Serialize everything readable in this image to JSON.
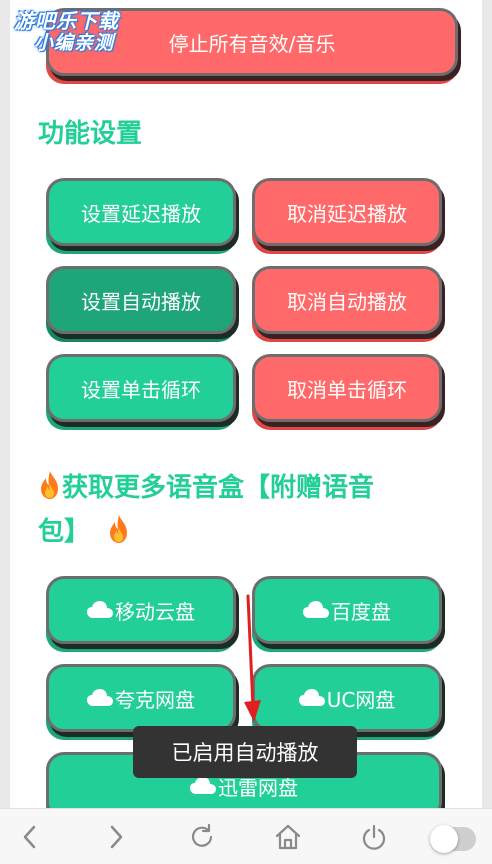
{
  "watermark": {
    "line1": "游吧乐下载",
    "line2": "小编亲测"
  },
  "top_button": {
    "label": "停止所有音效/音乐"
  },
  "settings": {
    "title": "功能设置",
    "buttons": [
      {
        "label": "设置延迟播放",
        "style": "green"
      },
      {
        "label": "取消延迟播放",
        "style": "red"
      },
      {
        "label": "设置自动播放",
        "style": "green-active"
      },
      {
        "label": "取消自动播放",
        "style": "red"
      },
      {
        "label": "设置单击循环",
        "style": "green"
      },
      {
        "label": "取消单击循环",
        "style": "red"
      }
    ]
  },
  "more": {
    "title_part1": "获取更多语音盒【附赠语音",
    "title_part2": "包】",
    "icon": "fire-icon",
    "links": [
      {
        "label": "移动云盘",
        "icon": "cloud-icon"
      },
      {
        "label": "百度盘",
        "icon": "cloud-icon"
      },
      {
        "label": "夸克网盘",
        "icon": "cloud-icon"
      },
      {
        "label": "UC网盘",
        "icon": "cloud-icon"
      },
      {
        "label": "迅雷网盘",
        "icon": "cloud-icon"
      }
    ]
  },
  "toast": {
    "text": "已启用自动播放"
  },
  "bottom_nav": {
    "items": [
      "back-icon",
      "forward-icon",
      "refresh-icon",
      "home-icon",
      "power-icon",
      "toggle"
    ]
  },
  "colors": {
    "green": "#22cf98",
    "red": "#ff6969",
    "dark_green": "#1ea57a",
    "toast_bg": "#333333",
    "arrow": "#e02020"
  }
}
